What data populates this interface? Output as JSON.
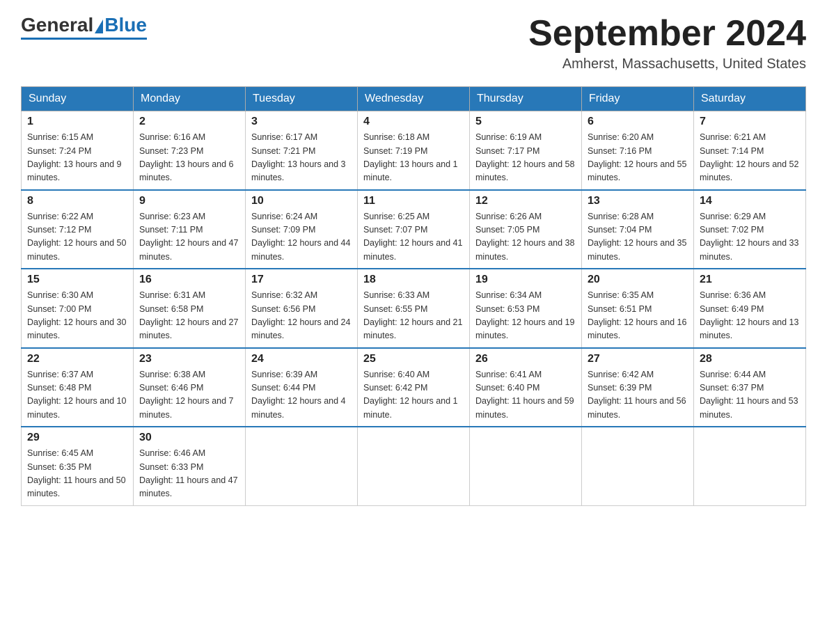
{
  "logo": {
    "general": "General",
    "blue": "Blue"
  },
  "header": {
    "month_year": "September 2024",
    "location": "Amherst, Massachusetts, United States"
  },
  "weekdays": [
    "Sunday",
    "Monday",
    "Tuesday",
    "Wednesday",
    "Thursday",
    "Friday",
    "Saturday"
  ],
  "weeks": [
    [
      {
        "day": "1",
        "sunrise": "6:15 AM",
        "sunset": "7:24 PM",
        "daylight": "13 hours and 9 minutes."
      },
      {
        "day": "2",
        "sunrise": "6:16 AM",
        "sunset": "7:23 PM",
        "daylight": "13 hours and 6 minutes."
      },
      {
        "day": "3",
        "sunrise": "6:17 AM",
        "sunset": "7:21 PM",
        "daylight": "13 hours and 3 minutes."
      },
      {
        "day": "4",
        "sunrise": "6:18 AM",
        "sunset": "7:19 PM",
        "daylight": "13 hours and 1 minute."
      },
      {
        "day": "5",
        "sunrise": "6:19 AM",
        "sunset": "7:17 PM",
        "daylight": "12 hours and 58 minutes."
      },
      {
        "day": "6",
        "sunrise": "6:20 AM",
        "sunset": "7:16 PM",
        "daylight": "12 hours and 55 minutes."
      },
      {
        "day": "7",
        "sunrise": "6:21 AM",
        "sunset": "7:14 PM",
        "daylight": "12 hours and 52 minutes."
      }
    ],
    [
      {
        "day": "8",
        "sunrise": "6:22 AM",
        "sunset": "7:12 PM",
        "daylight": "12 hours and 50 minutes."
      },
      {
        "day": "9",
        "sunrise": "6:23 AM",
        "sunset": "7:11 PM",
        "daylight": "12 hours and 47 minutes."
      },
      {
        "day": "10",
        "sunrise": "6:24 AM",
        "sunset": "7:09 PM",
        "daylight": "12 hours and 44 minutes."
      },
      {
        "day": "11",
        "sunrise": "6:25 AM",
        "sunset": "7:07 PM",
        "daylight": "12 hours and 41 minutes."
      },
      {
        "day": "12",
        "sunrise": "6:26 AM",
        "sunset": "7:05 PM",
        "daylight": "12 hours and 38 minutes."
      },
      {
        "day": "13",
        "sunrise": "6:28 AM",
        "sunset": "7:04 PM",
        "daylight": "12 hours and 35 minutes."
      },
      {
        "day": "14",
        "sunrise": "6:29 AM",
        "sunset": "7:02 PM",
        "daylight": "12 hours and 33 minutes."
      }
    ],
    [
      {
        "day": "15",
        "sunrise": "6:30 AM",
        "sunset": "7:00 PM",
        "daylight": "12 hours and 30 minutes."
      },
      {
        "day": "16",
        "sunrise": "6:31 AM",
        "sunset": "6:58 PM",
        "daylight": "12 hours and 27 minutes."
      },
      {
        "day": "17",
        "sunrise": "6:32 AM",
        "sunset": "6:56 PM",
        "daylight": "12 hours and 24 minutes."
      },
      {
        "day": "18",
        "sunrise": "6:33 AM",
        "sunset": "6:55 PM",
        "daylight": "12 hours and 21 minutes."
      },
      {
        "day": "19",
        "sunrise": "6:34 AM",
        "sunset": "6:53 PM",
        "daylight": "12 hours and 19 minutes."
      },
      {
        "day": "20",
        "sunrise": "6:35 AM",
        "sunset": "6:51 PM",
        "daylight": "12 hours and 16 minutes."
      },
      {
        "day": "21",
        "sunrise": "6:36 AM",
        "sunset": "6:49 PM",
        "daylight": "12 hours and 13 minutes."
      }
    ],
    [
      {
        "day": "22",
        "sunrise": "6:37 AM",
        "sunset": "6:48 PM",
        "daylight": "12 hours and 10 minutes."
      },
      {
        "day": "23",
        "sunrise": "6:38 AM",
        "sunset": "6:46 PM",
        "daylight": "12 hours and 7 minutes."
      },
      {
        "day": "24",
        "sunrise": "6:39 AM",
        "sunset": "6:44 PM",
        "daylight": "12 hours and 4 minutes."
      },
      {
        "day": "25",
        "sunrise": "6:40 AM",
        "sunset": "6:42 PM",
        "daylight": "12 hours and 1 minute."
      },
      {
        "day": "26",
        "sunrise": "6:41 AM",
        "sunset": "6:40 PM",
        "daylight": "11 hours and 59 minutes."
      },
      {
        "day": "27",
        "sunrise": "6:42 AM",
        "sunset": "6:39 PM",
        "daylight": "11 hours and 56 minutes."
      },
      {
        "day": "28",
        "sunrise": "6:44 AM",
        "sunset": "6:37 PM",
        "daylight": "11 hours and 53 minutes."
      }
    ],
    [
      {
        "day": "29",
        "sunrise": "6:45 AM",
        "sunset": "6:35 PM",
        "daylight": "11 hours and 50 minutes."
      },
      {
        "day": "30",
        "sunrise": "6:46 AM",
        "sunset": "6:33 PM",
        "daylight": "11 hours and 47 minutes."
      },
      null,
      null,
      null,
      null,
      null
    ]
  ]
}
